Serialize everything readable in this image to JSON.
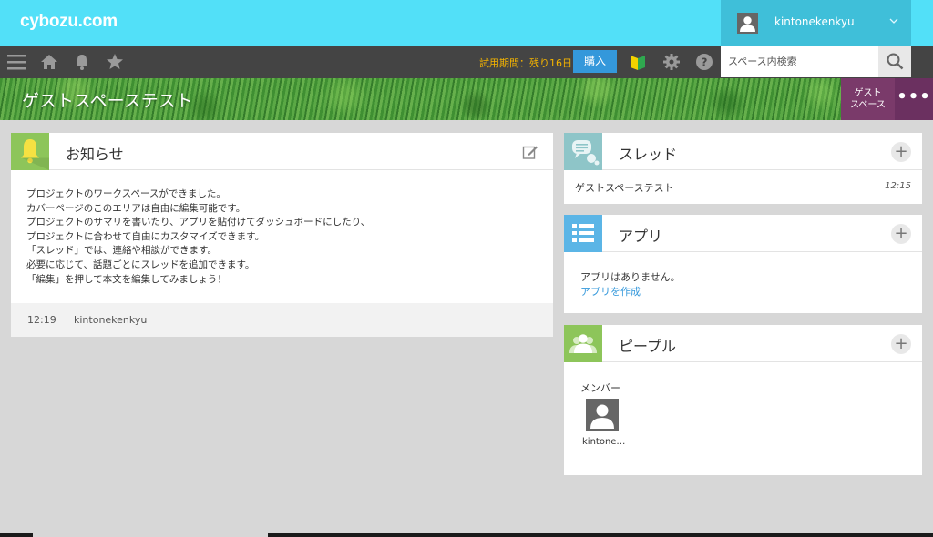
{
  "header": {
    "logo": "cybozu.com",
    "user_name": "kintonekenkyu"
  },
  "toolbar": {
    "icons": [
      "menu-icon",
      "home-icon",
      "bell-icon",
      "star-icon",
      "beginner-mark-icon",
      "gear-icon",
      "help-icon"
    ],
    "trial_text": "試用期間：残り16日",
    "buy_label": "購入",
    "search_placeholder": "スペース内検索"
  },
  "cover": {
    "title": "ゲストスペーステスト",
    "guest_badge_line1": "ゲスト",
    "guest_badge_line2": "スペース",
    "more_label": "•••"
  },
  "notice": {
    "title": "お知らせ",
    "lines": [
      "プロジェクトのワークスペースができました。",
      "カバーページのこのエリアは自由に編集可能です。",
      "プロジェクトのサマリを書いたり、アプリを貼付けてダッシュボードにしたり、",
      "プロジェクトに合わせて自由にカスタマイズできます。",
      "「スレッド」では、連絡や相談ができます。",
      "必要に応じて、話題ごとにスレッドを追加できます。",
      "「編集」を押して本文を編集してみましょう！"
    ],
    "footer_time": "12:19",
    "footer_user": "kintonekenkyu"
  },
  "thread": {
    "title": "スレッド",
    "items": [
      {
        "name": "ゲストスペーステスト",
        "time": "12:15"
      }
    ]
  },
  "apps": {
    "title": "アプリ",
    "empty_text": "アプリはありません。",
    "create_link": "アプリを作成"
  },
  "people": {
    "title": "ピープル",
    "members_label": "メンバー",
    "members": [
      {
        "name": "kintone…"
      }
    ]
  },
  "colors": {
    "header_bg": "#52e0f8",
    "toolbar_bg": "#444444",
    "buy_button": "#3498db",
    "trial_text": "#f5b400",
    "notice_icon_bg": "#8dc55a",
    "thread_icon_bg": "#8ec5c8",
    "apps_icon_bg": "#5bb5e6",
    "people_icon_bg": "#8dc55a",
    "guest_badge": "#7a3a6a"
  }
}
